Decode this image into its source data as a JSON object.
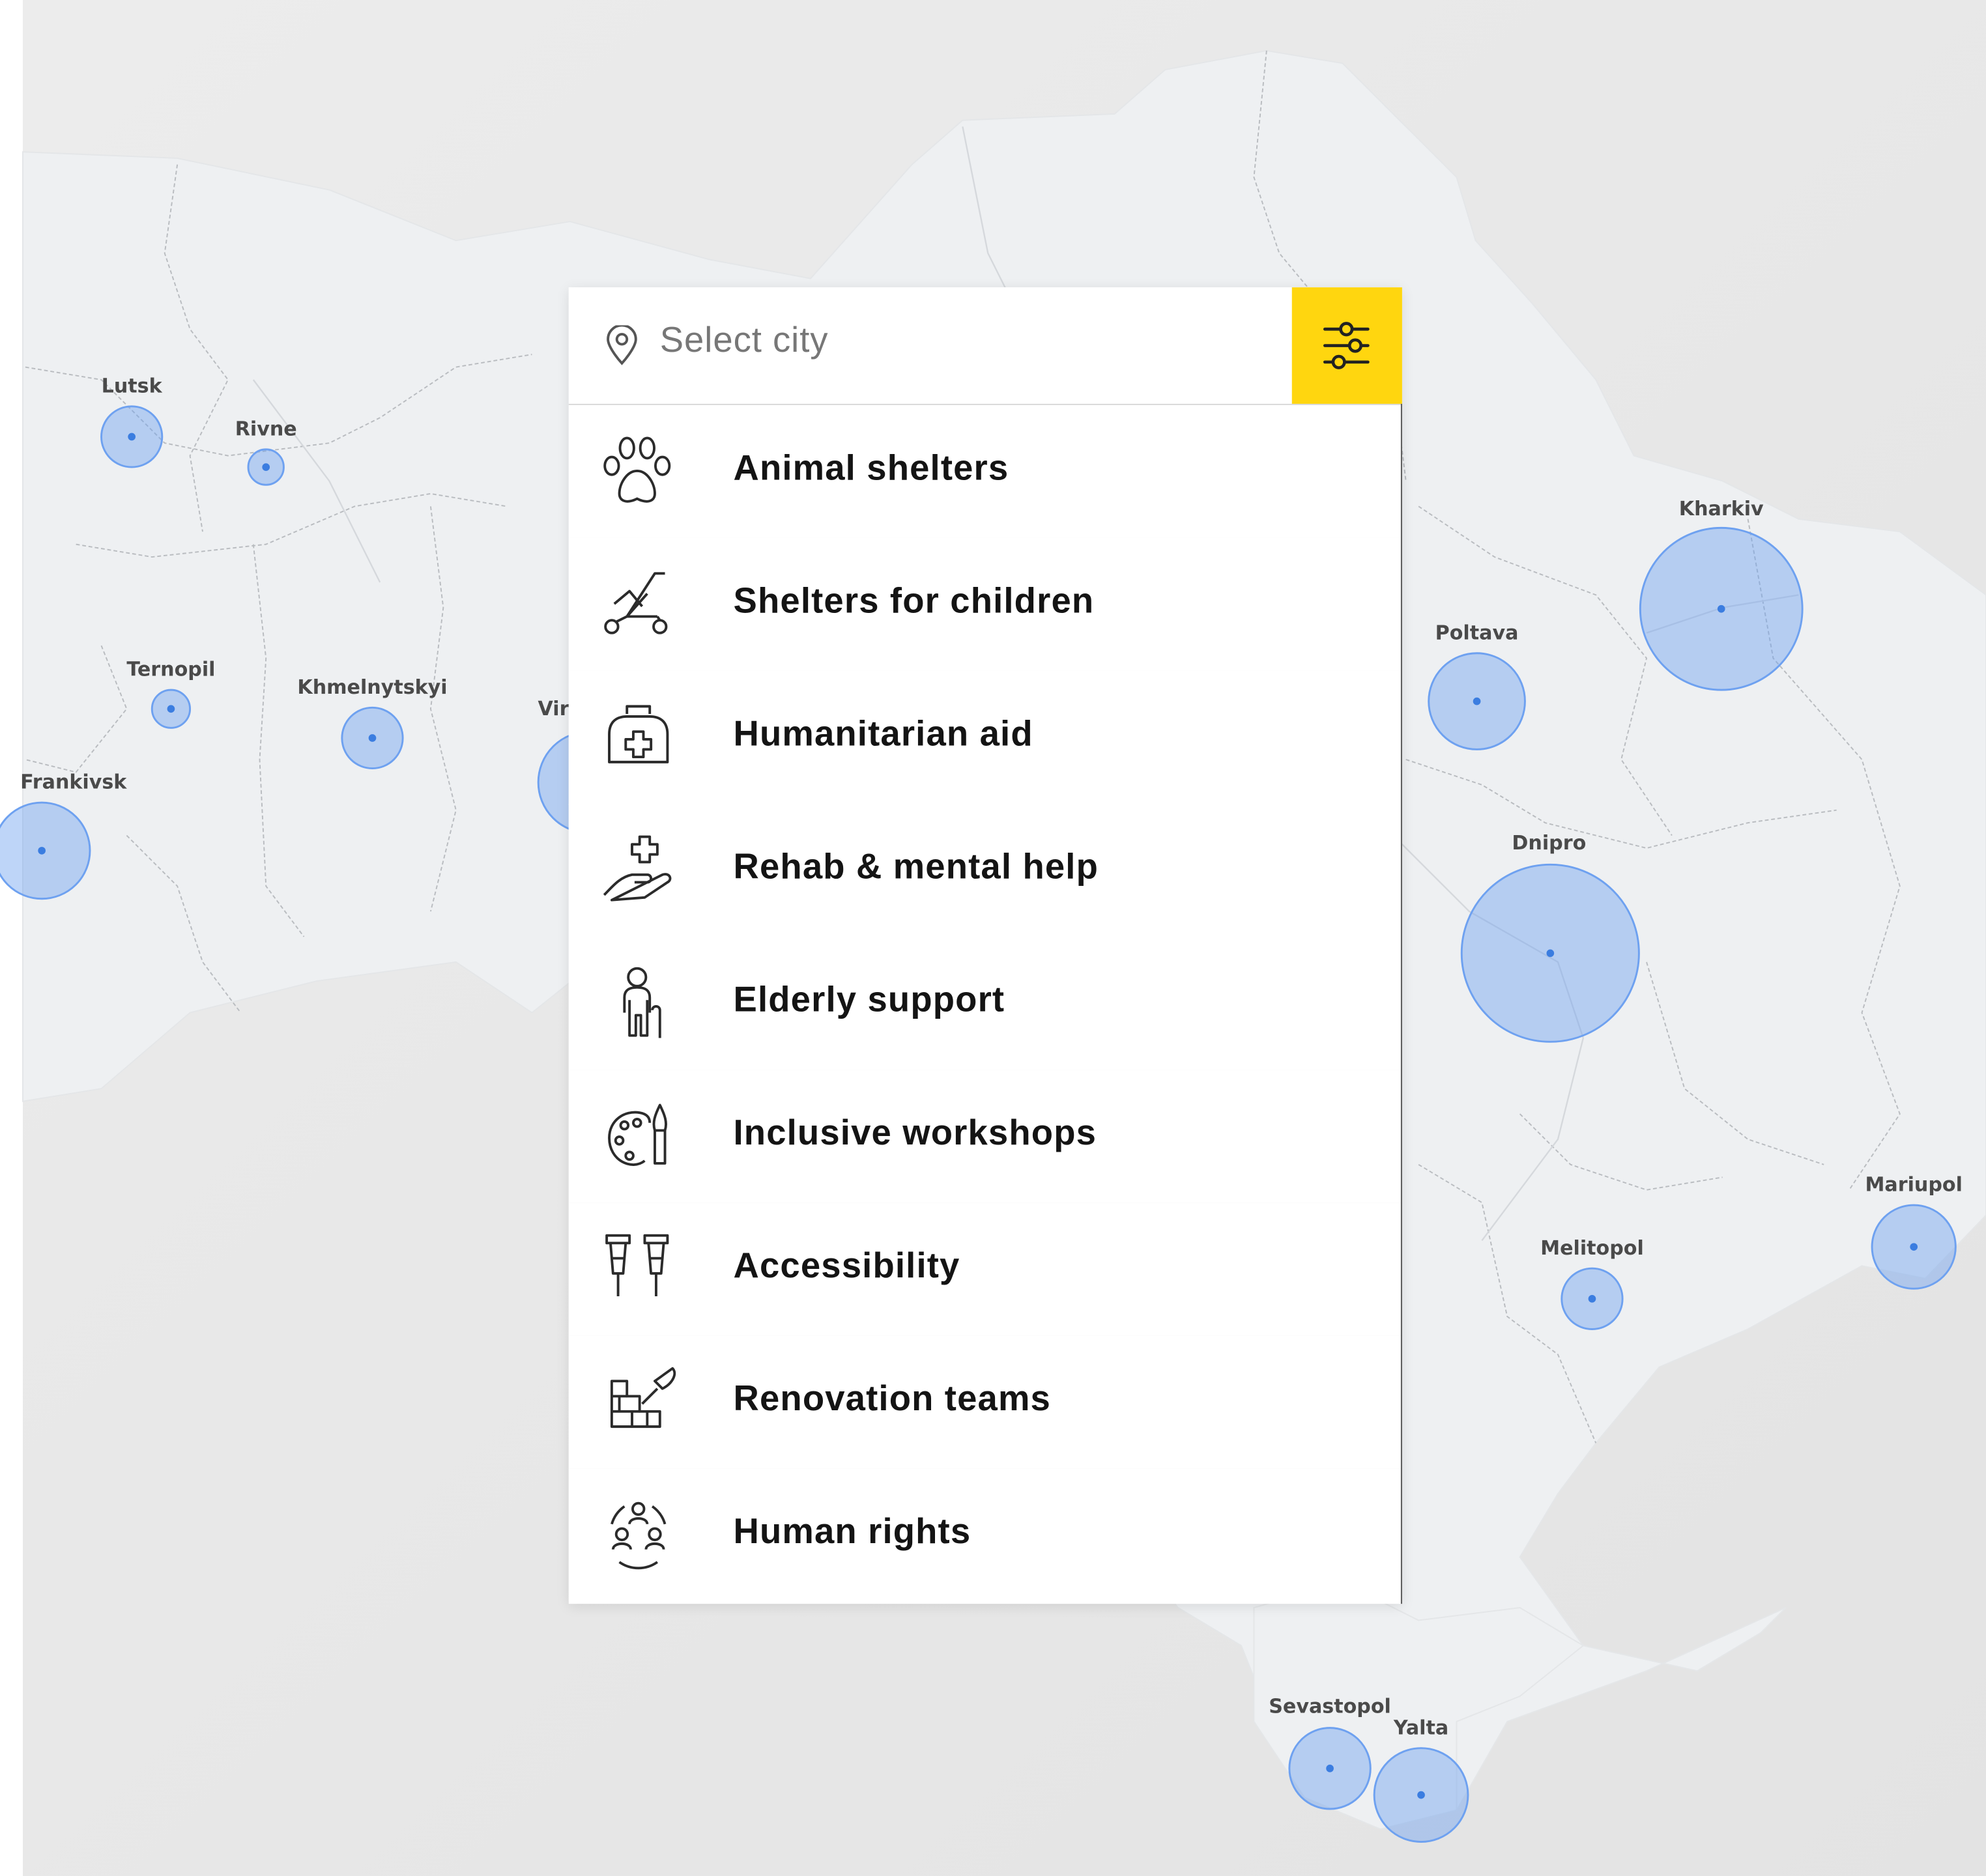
{
  "search": {
    "placeholder": "Select city",
    "pin_icon": "location-pin-icon",
    "filter_icon": "sliders-icon",
    "accent_color": "#ffd60f"
  },
  "categories": [
    {
      "label": "Animal shelters",
      "icon": "paw-icon"
    },
    {
      "label": "Shelters for children",
      "icon": "stroller-icon"
    },
    {
      "label": "Humanitarian aid",
      "icon": "first-aid-kit-icon"
    },
    {
      "label": "Rehab & mental help",
      "icon": "hand-with-cross-icon"
    },
    {
      "label": "Elderly support",
      "icon": "elderly-person-icon"
    },
    {
      "label": "Inclusive workshops",
      "icon": "palette-brush-icon"
    },
    {
      "label": "Accessibility",
      "icon": "crutches-icon"
    },
    {
      "label": "Renovation teams",
      "icon": "bricks-trowel-icon"
    },
    {
      "label": "Human rights",
      "icon": "people-circle-icon"
    }
  ],
  "map": {
    "marker_color": "#6ea1f0",
    "cities": [
      {
        "name": "Lutsk"
      },
      {
        "name": "Rivne"
      },
      {
        "name": "Ternopil"
      },
      {
        "name": "Khmelnytskyi"
      },
      {
        "name": "Frankivsk"
      },
      {
        "name": "Vir"
      },
      {
        "name": "Kharkiv"
      },
      {
        "name": "Poltava"
      },
      {
        "name": "Dnipro"
      },
      {
        "name": "Mariupol"
      },
      {
        "name": "Melitopol"
      },
      {
        "name": "Sevastopol"
      },
      {
        "name": "Yalta"
      }
    ]
  }
}
